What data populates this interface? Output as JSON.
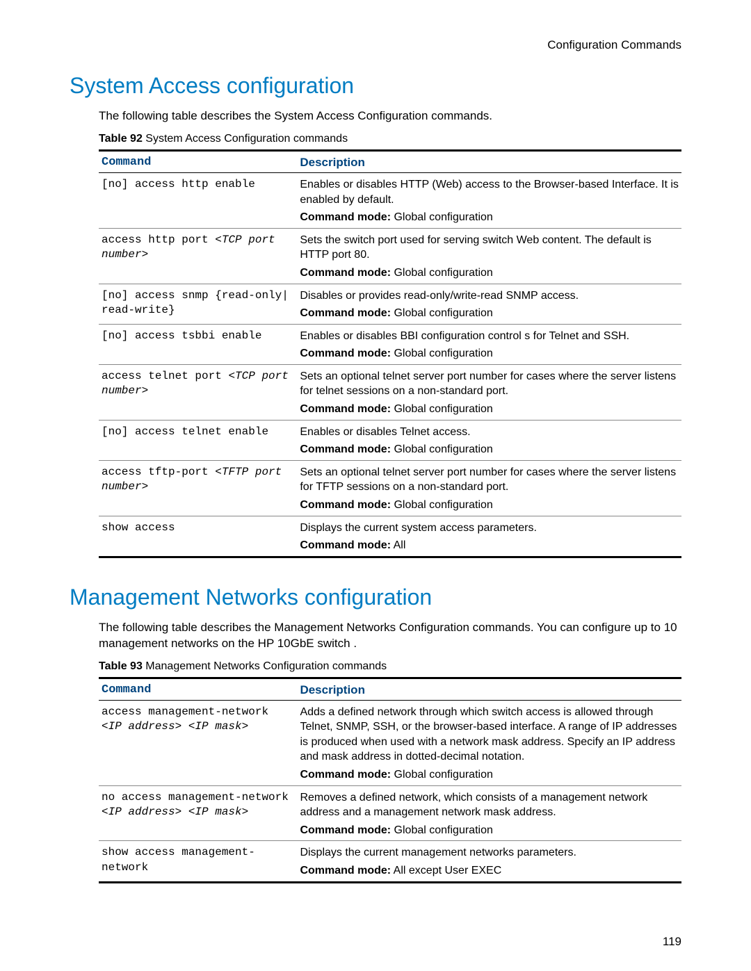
{
  "header": {
    "right": "Configuration Commands"
  },
  "page_number": "119",
  "section1": {
    "title": "System Access configuration",
    "intro": "The following table describes the System Access Configuration commands.",
    "table_caption_num": "Table 92",
    "table_caption_txt": " System Access Configuration commands",
    "col_command": "Command",
    "col_description": "Description",
    "mode_label": "Command mode:",
    "rows": [
      {
        "cmd": "[no] access http enable",
        "cmd_italic": "",
        "desc": "Enables or disables HTTP (Web) access to the Browser-based Interface. It is enabled by default.",
        "mode": " Global configuration"
      },
      {
        "cmd": "access http port ",
        "cmd_italic": "<TCP port number>",
        "desc": "Sets the switch port used for serving switch Web content. The default is HTTP port 80.",
        "mode": " Global configuration"
      },
      {
        "cmd": "[no] access snmp {read-only| read-write}",
        "cmd_italic": "",
        "desc": "Disables or provides read-only/write-read SNMP access.",
        "mode": " Global configuration"
      },
      {
        "cmd": "[no] access tsbbi enable",
        "cmd_italic": "",
        "desc": "Enables or disables BBI configuration control s for Telnet and SSH.",
        "mode": " Global configuration"
      },
      {
        "cmd": "access telnet port ",
        "cmd_italic": "<TCP port number>",
        "desc": "Sets an optional telnet server port number for cases where the server listens for telnet sessions on a non-standard port.",
        "mode": " Global configuration"
      },
      {
        "cmd": "[no] access telnet enable",
        "cmd_italic": "",
        "desc": "Enables or disables Telnet access.",
        "mode": " Global configuration"
      },
      {
        "cmd": "access tftp-port ",
        "cmd_italic": "<TFTP port number>",
        "desc": "Sets an optional telnet server port number for cases where the server listens for TFTP sessions on a non-standard port.",
        "mode": " Global configuration"
      },
      {
        "cmd": "show access",
        "cmd_italic": "",
        "desc": "Displays the current system access parameters.",
        "mode": " All"
      }
    ]
  },
  "section2": {
    "title": "Management Networks configuration",
    "intro": "The following table describes the Management Networks Configuration commands. You can configure up to 10 management networks on the HP 10GbE switch .",
    "table_caption_num": "Table 93",
    "table_caption_txt": " Management Networks Configuration commands",
    "col_command": "Command",
    "col_description": "Description",
    "mode_label": "Command mode:",
    "rows": [
      {
        "cmd": "access management-network ",
        "cmd_italic": "<IP address> <IP mask>",
        "desc": "Adds a defined network through which switch access is allowed through Telnet, SNMP, SSH, or the browser-based interface. A range of IP addresses is produced when used with a network mask address. Specify an IP address and mask address in dotted-decimal notation.",
        "mode": " Global configuration"
      },
      {
        "cmd": "no access management-network ",
        "cmd_italic": "<IP address> <IP mask>",
        "desc": "Removes a defined network, which consists of a management network address and a management network mask address.",
        "mode": " Global configuration"
      },
      {
        "cmd": "show access management-network",
        "cmd_italic": "",
        "desc": "Displays the current management networks parameters.",
        "mode": " All except User EXEC"
      }
    ]
  }
}
